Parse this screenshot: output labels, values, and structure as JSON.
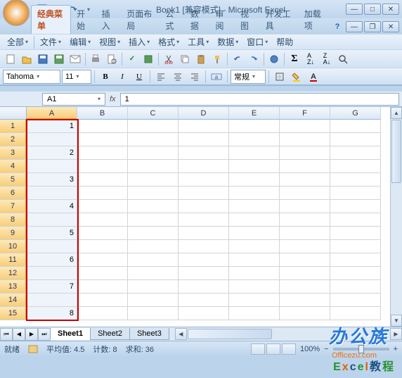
{
  "title": "Book1 [兼容模式] - Microsoft Excel",
  "ribbon_tabs": [
    "经典菜单",
    "开始",
    "插入",
    "页面布局",
    "公式",
    "数据",
    "审阅",
    "视图",
    "开发工具",
    "加载项"
  ],
  "active_ribbon_tab": 0,
  "menu": {
    "all": "全部",
    "file": "文件",
    "edit": "编辑",
    "view": "视图",
    "insert": "插入",
    "format": "格式",
    "tools": "工具",
    "data": "数据",
    "window": "窗口",
    "help": "帮助"
  },
  "font": {
    "name": "Tahoma",
    "size": "11"
  },
  "number_format_label": "常规",
  "name_box": "A1",
  "formula_value": "1",
  "columns": [
    "A",
    "B",
    "C",
    "D",
    "E",
    "F",
    "G"
  ],
  "rows": [
    1,
    2,
    3,
    4,
    5,
    6,
    7,
    8,
    9,
    10,
    11,
    12,
    13,
    14,
    15
  ],
  "cells_colA": [
    "1",
    "",
    "2",
    "",
    "3",
    "",
    "4",
    "",
    "5",
    "",
    "6",
    "",
    "7",
    "",
    "8"
  ],
  "sheets": [
    "Sheet1",
    "Sheet2",
    "Sheet3"
  ],
  "active_sheet": 0,
  "status": {
    "ready": "就绪",
    "avg_label": "平均值:",
    "avg": "4.5",
    "count_label": "计数:",
    "count": "8",
    "sum_label": "求和:",
    "sum": "36",
    "zoom": "100%"
  },
  "watermark": {
    "brand": "办公族",
    "site": "Officezu.com",
    "tutorial": "Excel教程"
  }
}
